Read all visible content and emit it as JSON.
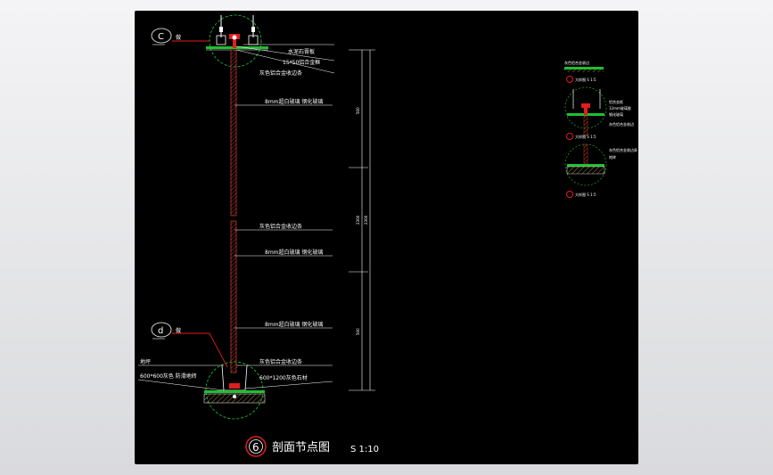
{
  "title": "剖面节点图",
  "scale": "S 1:10",
  "detail_number": "6",
  "callouts": {
    "top_letter": "C",
    "top_label": "做",
    "bottom_letter": "d",
    "bottom_label": "做"
  },
  "annotations": {
    "top_1": "水泥石膏板",
    "top_2": "15*50铝合金框",
    "top_3": "灰色铝合金收边条",
    "mid_1": "8mm超白玻璃 钢化玻璃",
    "mid_2": "灰色铝合金收边条",
    "mid_3": "8mm超白玻璃 钢化玻璃",
    "mid_4": "8mm超白玻璃 钢化玻璃",
    "bot_1": "灰色铝合金收边条",
    "bot_2": "600*1200灰色石材",
    "left_1": "地坪",
    "left_2": "600*600灰色 防滑地砖"
  },
  "dimensions": {
    "d1": "500",
    "d2": "2300",
    "d3": "2300",
    "d4": "500"
  },
  "mini": {
    "label_1": "灰色铝合金收边",
    "ref_1": "大样图 S 1:5",
    "ref_2": "大样图 S 1:5",
    "ref_3": "大样图 S 1:5",
    "note_1": "铝合金框",
    "note_2": "12mm玻璃胶",
    "note_3": "钢化玻璃",
    "note_4": "灰色铝合金收边",
    "note_5": "灰色铝合金收边条",
    "note_6": "地砖"
  }
}
